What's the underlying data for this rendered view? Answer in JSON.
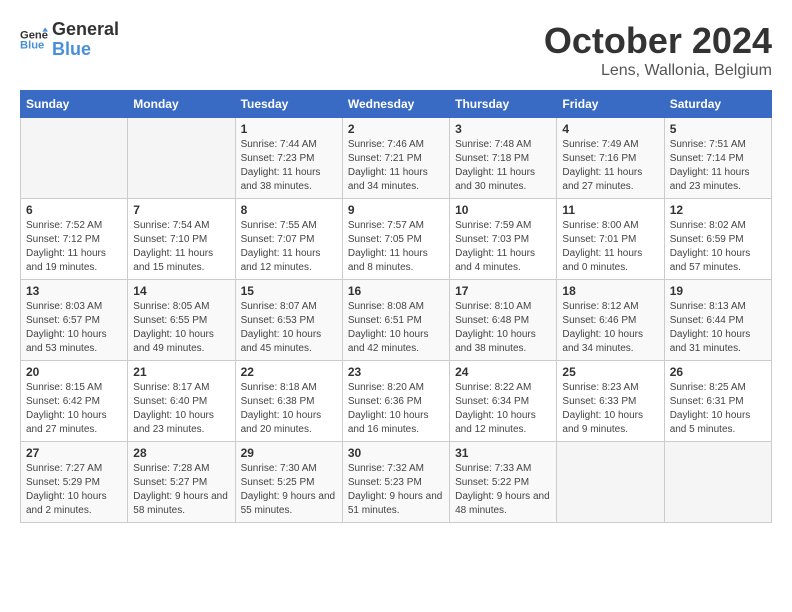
{
  "header": {
    "logo_general": "General",
    "logo_blue": "Blue",
    "month": "October 2024",
    "location": "Lens, Wallonia, Belgium"
  },
  "weekdays": [
    "Sunday",
    "Monday",
    "Tuesday",
    "Wednesday",
    "Thursday",
    "Friday",
    "Saturday"
  ],
  "weeks": [
    [
      {
        "day": "",
        "sunrise": "",
        "sunset": "",
        "daylight": ""
      },
      {
        "day": "",
        "sunrise": "",
        "sunset": "",
        "daylight": ""
      },
      {
        "day": "1",
        "sunrise": "Sunrise: 7:44 AM",
        "sunset": "Sunset: 7:23 PM",
        "daylight": "Daylight: 11 hours and 38 minutes."
      },
      {
        "day": "2",
        "sunrise": "Sunrise: 7:46 AM",
        "sunset": "Sunset: 7:21 PM",
        "daylight": "Daylight: 11 hours and 34 minutes."
      },
      {
        "day": "3",
        "sunrise": "Sunrise: 7:48 AM",
        "sunset": "Sunset: 7:18 PM",
        "daylight": "Daylight: 11 hours and 30 minutes."
      },
      {
        "day": "4",
        "sunrise": "Sunrise: 7:49 AM",
        "sunset": "Sunset: 7:16 PM",
        "daylight": "Daylight: 11 hours and 27 minutes."
      },
      {
        "day": "5",
        "sunrise": "Sunrise: 7:51 AM",
        "sunset": "Sunset: 7:14 PM",
        "daylight": "Daylight: 11 hours and 23 minutes."
      }
    ],
    [
      {
        "day": "6",
        "sunrise": "Sunrise: 7:52 AM",
        "sunset": "Sunset: 7:12 PM",
        "daylight": "Daylight: 11 hours and 19 minutes."
      },
      {
        "day": "7",
        "sunrise": "Sunrise: 7:54 AM",
        "sunset": "Sunset: 7:10 PM",
        "daylight": "Daylight: 11 hours and 15 minutes."
      },
      {
        "day": "8",
        "sunrise": "Sunrise: 7:55 AM",
        "sunset": "Sunset: 7:07 PM",
        "daylight": "Daylight: 11 hours and 12 minutes."
      },
      {
        "day": "9",
        "sunrise": "Sunrise: 7:57 AM",
        "sunset": "Sunset: 7:05 PM",
        "daylight": "Daylight: 11 hours and 8 minutes."
      },
      {
        "day": "10",
        "sunrise": "Sunrise: 7:59 AM",
        "sunset": "Sunset: 7:03 PM",
        "daylight": "Daylight: 11 hours and 4 minutes."
      },
      {
        "day": "11",
        "sunrise": "Sunrise: 8:00 AM",
        "sunset": "Sunset: 7:01 PM",
        "daylight": "Daylight: 11 hours and 0 minutes."
      },
      {
        "day": "12",
        "sunrise": "Sunrise: 8:02 AM",
        "sunset": "Sunset: 6:59 PM",
        "daylight": "Daylight: 10 hours and 57 minutes."
      }
    ],
    [
      {
        "day": "13",
        "sunrise": "Sunrise: 8:03 AM",
        "sunset": "Sunset: 6:57 PM",
        "daylight": "Daylight: 10 hours and 53 minutes."
      },
      {
        "day": "14",
        "sunrise": "Sunrise: 8:05 AM",
        "sunset": "Sunset: 6:55 PM",
        "daylight": "Daylight: 10 hours and 49 minutes."
      },
      {
        "day": "15",
        "sunrise": "Sunrise: 8:07 AM",
        "sunset": "Sunset: 6:53 PM",
        "daylight": "Daylight: 10 hours and 45 minutes."
      },
      {
        "day": "16",
        "sunrise": "Sunrise: 8:08 AM",
        "sunset": "Sunset: 6:51 PM",
        "daylight": "Daylight: 10 hours and 42 minutes."
      },
      {
        "day": "17",
        "sunrise": "Sunrise: 8:10 AM",
        "sunset": "Sunset: 6:48 PM",
        "daylight": "Daylight: 10 hours and 38 minutes."
      },
      {
        "day": "18",
        "sunrise": "Sunrise: 8:12 AM",
        "sunset": "Sunset: 6:46 PM",
        "daylight": "Daylight: 10 hours and 34 minutes."
      },
      {
        "day": "19",
        "sunrise": "Sunrise: 8:13 AM",
        "sunset": "Sunset: 6:44 PM",
        "daylight": "Daylight: 10 hours and 31 minutes."
      }
    ],
    [
      {
        "day": "20",
        "sunrise": "Sunrise: 8:15 AM",
        "sunset": "Sunset: 6:42 PM",
        "daylight": "Daylight: 10 hours and 27 minutes."
      },
      {
        "day": "21",
        "sunrise": "Sunrise: 8:17 AM",
        "sunset": "Sunset: 6:40 PM",
        "daylight": "Daylight: 10 hours and 23 minutes."
      },
      {
        "day": "22",
        "sunrise": "Sunrise: 8:18 AM",
        "sunset": "Sunset: 6:38 PM",
        "daylight": "Daylight: 10 hours and 20 minutes."
      },
      {
        "day": "23",
        "sunrise": "Sunrise: 8:20 AM",
        "sunset": "Sunset: 6:36 PM",
        "daylight": "Daylight: 10 hours and 16 minutes."
      },
      {
        "day": "24",
        "sunrise": "Sunrise: 8:22 AM",
        "sunset": "Sunset: 6:34 PM",
        "daylight": "Daylight: 10 hours and 12 minutes."
      },
      {
        "day": "25",
        "sunrise": "Sunrise: 8:23 AM",
        "sunset": "Sunset: 6:33 PM",
        "daylight": "Daylight: 10 hours and 9 minutes."
      },
      {
        "day": "26",
        "sunrise": "Sunrise: 8:25 AM",
        "sunset": "Sunset: 6:31 PM",
        "daylight": "Daylight: 10 hours and 5 minutes."
      }
    ],
    [
      {
        "day": "27",
        "sunrise": "Sunrise: 7:27 AM",
        "sunset": "Sunset: 5:29 PM",
        "daylight": "Daylight: 10 hours and 2 minutes."
      },
      {
        "day": "28",
        "sunrise": "Sunrise: 7:28 AM",
        "sunset": "Sunset: 5:27 PM",
        "daylight": "Daylight: 9 hours and 58 minutes."
      },
      {
        "day": "29",
        "sunrise": "Sunrise: 7:30 AM",
        "sunset": "Sunset: 5:25 PM",
        "daylight": "Daylight: 9 hours and 55 minutes."
      },
      {
        "day": "30",
        "sunrise": "Sunrise: 7:32 AM",
        "sunset": "Sunset: 5:23 PM",
        "daylight": "Daylight: 9 hours and 51 minutes."
      },
      {
        "day": "31",
        "sunrise": "Sunrise: 7:33 AM",
        "sunset": "Sunset: 5:22 PM",
        "daylight": "Daylight: 9 hours and 48 minutes."
      },
      {
        "day": "",
        "sunrise": "",
        "sunset": "",
        "daylight": ""
      },
      {
        "day": "",
        "sunrise": "",
        "sunset": "",
        "daylight": ""
      }
    ]
  ]
}
